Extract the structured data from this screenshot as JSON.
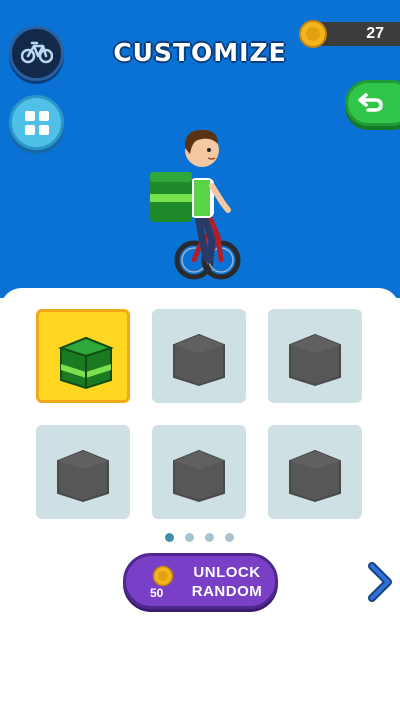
{
  "header": {
    "title": "CUSTOMIZE",
    "coin_count": "27",
    "bike_icon": "bike-icon",
    "grid_icon": "grid-icon",
    "back_icon": "return-arrow-icon"
  },
  "colors": {
    "sky": "#0a72d4",
    "selected_tile": "#ffd722",
    "locked_tile": "#cfe0e4",
    "unlock_button": "#7a3fc7",
    "back_button": "#31c64a"
  },
  "items": [
    {
      "state": "selected",
      "icon": "green-backpack-icon"
    },
    {
      "state": "locked",
      "icon": "locked-backpack-icon"
    },
    {
      "state": "locked",
      "icon": "locked-backpack-icon"
    },
    {
      "state": "locked",
      "icon": "locked-backpack-icon"
    },
    {
      "state": "locked",
      "icon": "locked-backpack-icon"
    },
    {
      "state": "locked",
      "icon": "locked-backpack-icon"
    }
  ],
  "pager": {
    "pages": 4,
    "active_index": 0
  },
  "unlock": {
    "cost": "50",
    "line1": "UNLOCK",
    "line2": "RANDOM"
  }
}
